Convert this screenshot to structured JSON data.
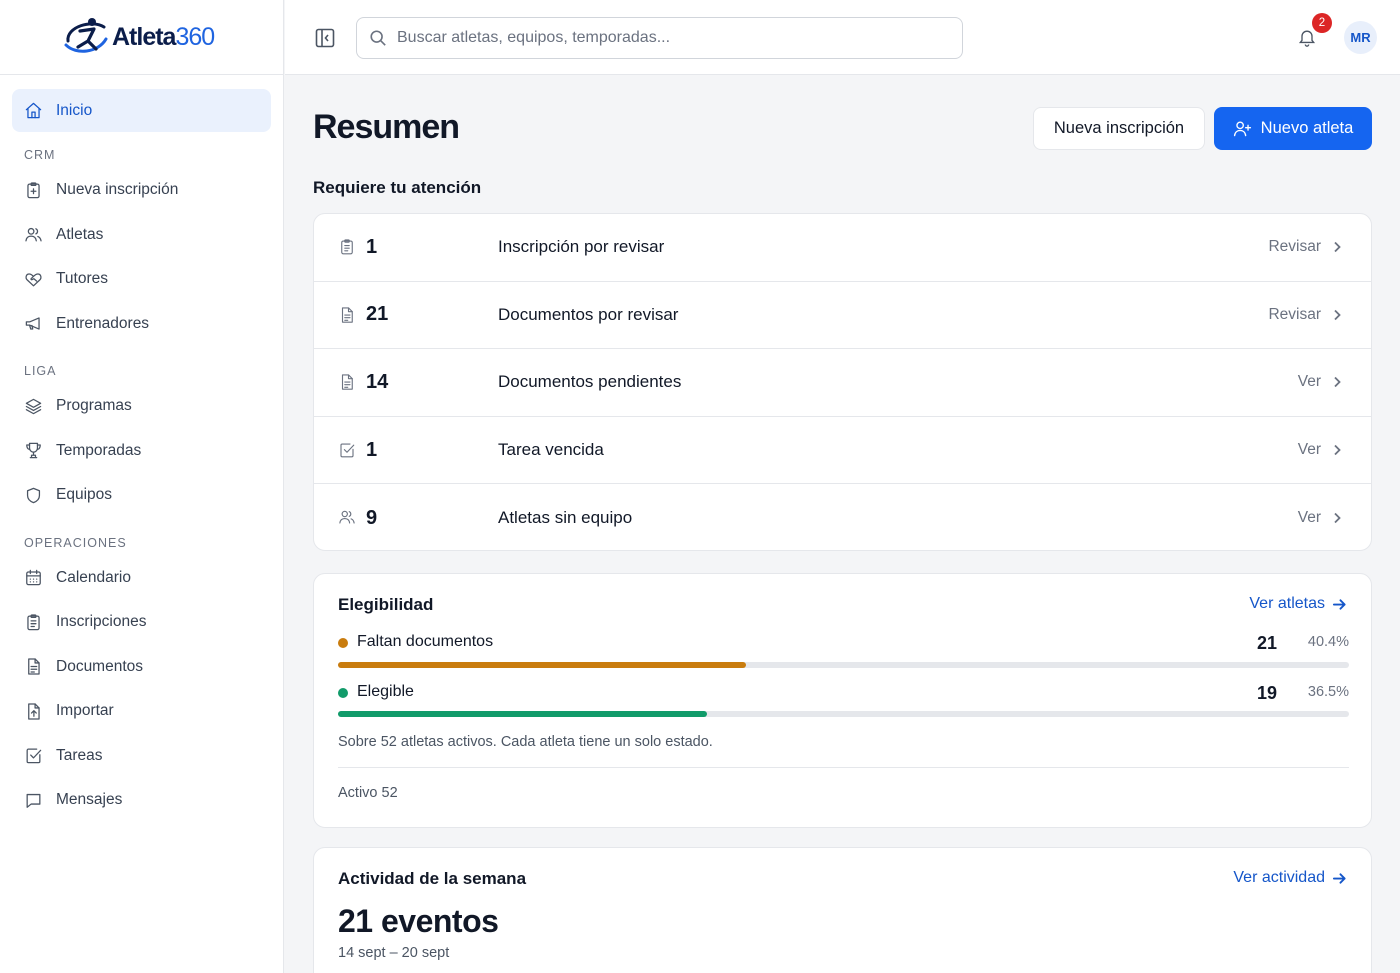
{
  "app": {
    "brand_name": "Atleta",
    "brand_number": "360"
  },
  "sidebar": {
    "home": {
      "label": "Inicio",
      "icon": "home-icon"
    },
    "sections": [
      {
        "title": "CRM",
        "items": [
          {
            "label": "Nueva inscripción",
            "icon": "clipboard-plus-icon"
          },
          {
            "label": "Atletas",
            "icon": "users-icon"
          },
          {
            "label": "Tutores",
            "icon": "heart-handshake-icon"
          },
          {
            "label": "Entrenadores",
            "icon": "megaphone-icon"
          }
        ]
      },
      {
        "title": "LIGA",
        "items": [
          {
            "label": "Programas",
            "icon": "layers-icon"
          },
          {
            "label": "Temporadas",
            "icon": "trophy-icon"
          },
          {
            "label": "Equipos",
            "icon": "shield-icon"
          }
        ]
      },
      {
        "title": "OPERACIONES",
        "items": [
          {
            "label": "Calendario",
            "icon": "calendar-icon"
          },
          {
            "label": "Inscripciones",
            "icon": "clipboard-list-icon"
          },
          {
            "label": "Documentos",
            "icon": "file-text-icon"
          },
          {
            "label": "Importar",
            "icon": "file-upload-icon"
          },
          {
            "label": "Tareas",
            "icon": "checkbox-icon"
          },
          {
            "label": "Mensajes",
            "icon": "message-icon"
          }
        ]
      }
    ]
  },
  "topbar": {
    "search_placeholder": "Buscar atletas, equipos, temporadas...",
    "notifications_count": "2",
    "avatar_initials": "MR"
  },
  "page": {
    "title": "Resumen",
    "secondary_button": "Nueva inscripción",
    "primary_button": "Nuevo atleta"
  },
  "attention": {
    "title": "Requiere tu atención",
    "rows": [
      {
        "count": "1",
        "label": "Inscripción por revisar",
        "action": "Revisar",
        "icon": "clipboard-icon"
      },
      {
        "count": "21",
        "label": "Documentos por revisar",
        "action": "Revisar",
        "icon": "file-text-icon"
      },
      {
        "count": "14",
        "label": "Documentos pendientes",
        "action": "Ver",
        "icon": "file-text-icon"
      },
      {
        "count": "1",
        "label": "Tarea vencida",
        "action": "Ver",
        "icon": "checkbox-icon"
      },
      {
        "count": "9",
        "label": "Atletas sin equipo",
        "action": "Ver",
        "icon": "users-icon"
      }
    ]
  },
  "eligibility": {
    "title": "Elegibilidad",
    "link": "Ver atletas",
    "rows": [
      {
        "name": "Faltan documentos",
        "count": "21",
        "percent": "40.4%",
        "fraction": 0.404,
        "color": "#c97c0e"
      },
      {
        "name": "Elegible",
        "count": "19",
        "percent": "36.5%",
        "fraction": 0.365,
        "color": "#119b6a"
      }
    ],
    "note": "Sobre 52 atletas activos. Cada atleta tiene un solo estado.",
    "footer": "Activo 52"
  },
  "activity": {
    "title": "Actividad de la semana",
    "link": "Ver actividad",
    "total": "21 eventos",
    "range": "14 sept – 20 sept"
  },
  "colors": {
    "primary": "#1565f0",
    "active_nav_bg": "#eaf1fd",
    "badge": "#dc2626"
  }
}
